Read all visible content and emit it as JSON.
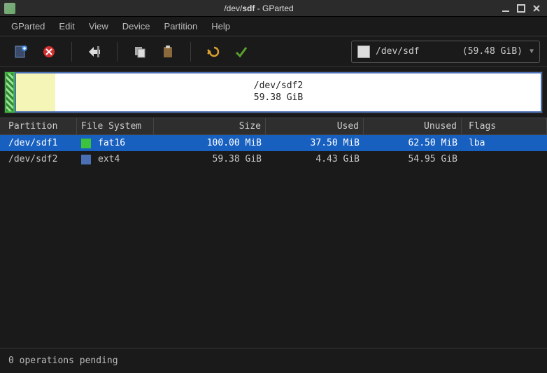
{
  "titlebar": {
    "title_plain": "/dev/",
    "title_bold": "sdf",
    "title_suffix": " - GParted"
  },
  "menubar": {
    "items": [
      "GParted",
      "Edit",
      "View",
      "Device",
      "Partition",
      "Help"
    ]
  },
  "toolbar": {
    "icons": [
      "new-partition",
      "delete-partition",
      "resize-move",
      "copy",
      "paste",
      "undo",
      "apply"
    ]
  },
  "device_selector": {
    "device": "/dev/sdf",
    "size": "(59.48 GiB)"
  },
  "partition_map": {
    "large_label_line1": "/dev/sdf2",
    "large_label_line2": "59.38 GiB"
  },
  "columns": {
    "partition": "Partition",
    "fs": "File System",
    "size": "Size",
    "used": "Used",
    "unused": "Unused",
    "flags": "Flags"
  },
  "rows": [
    {
      "partition": "/dev/sdf1",
      "fs": "fat16",
      "fs_color": "fs-fat16",
      "size": "100.00 MiB",
      "used": "37.50 MiB",
      "unused": "62.50 MiB",
      "flags": "lba",
      "selected": true
    },
    {
      "partition": "/dev/sdf2",
      "fs": "ext4",
      "fs_color": "fs-ext4",
      "size": "59.38 GiB",
      "used": "4.43 GiB",
      "unused": "54.95 GiB",
      "flags": "",
      "selected": false
    }
  ],
  "statusbar": {
    "text": "0 operations pending"
  }
}
